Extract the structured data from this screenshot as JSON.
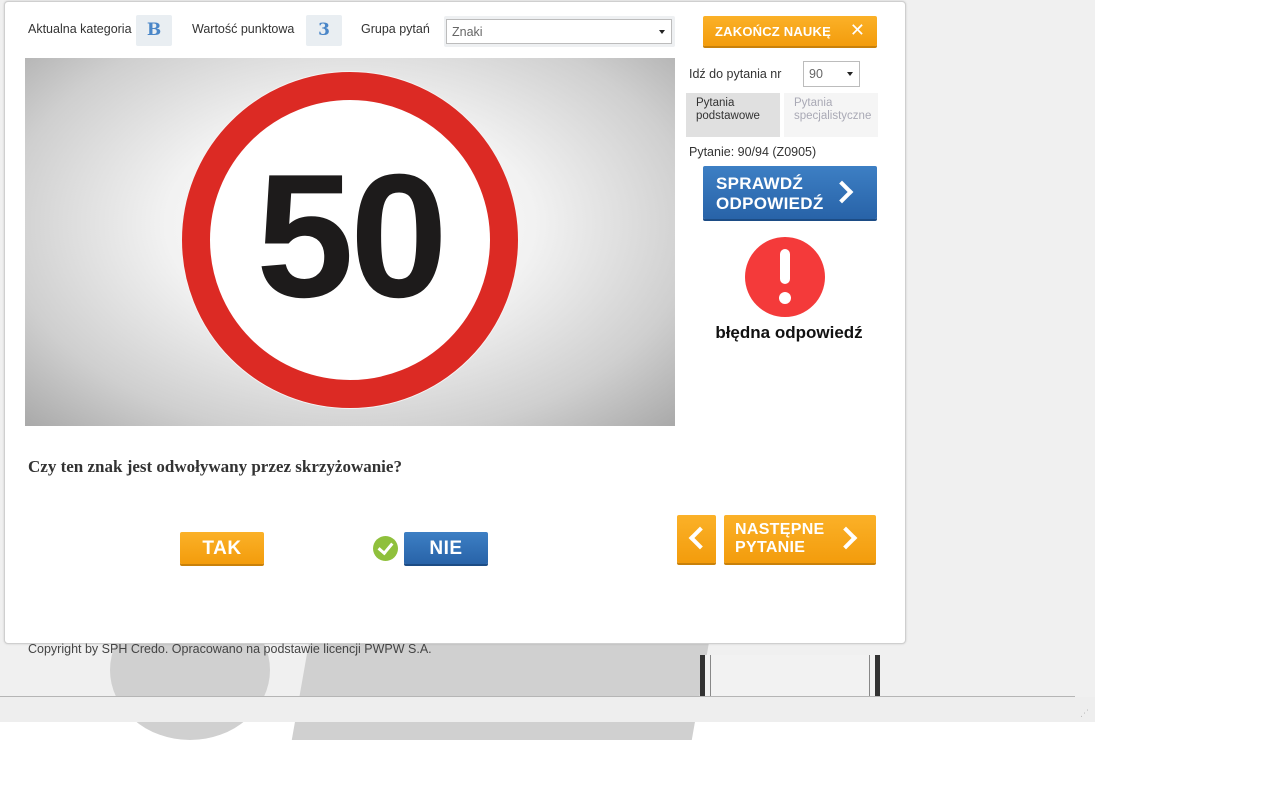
{
  "header": {
    "category_label": "Aktualna kategoria",
    "category_value": "B",
    "points_label": "Wartość punktowa",
    "points_value": "3",
    "group_label": "Grupa pytań",
    "group_selected": "Znaki",
    "end_label": "ZAKOŃCZ NAUKĘ",
    "end_icon": "close-icon"
  },
  "image": {
    "sign_value": "50"
  },
  "sidebar": {
    "goto_label": "Idź do pytania nr",
    "goto_selected": "90",
    "tabs": [
      {
        "line1": "Pytania",
        "line2": "podstawowe",
        "active": true
      },
      {
        "line1": "Pytania",
        "line2": "specjalistyczne",
        "active": false
      }
    ],
    "question_counter": "Pytanie: 90/94 (Z0905)",
    "check_line1": "SPRAWDŹ",
    "check_line2": "ODPOWIEDŹ",
    "result_icon": "exclamation-icon",
    "result_text": "błędna odpowiedź"
  },
  "question": {
    "text": "Czy ten znak jest odwoływany przez skrzyżowanie?",
    "answer_yes": "TAK",
    "answer_no": "NIE",
    "correct_marker": "check-icon"
  },
  "navigation": {
    "next_line1": "NASTĘPNE",
    "next_line2": "PYTANIE"
  },
  "footer": {
    "copyright": "Copyright by SPH Credo. Opracowano na podstawie licencji PWPW S.A."
  },
  "colors": {
    "orange": "#f7a41c",
    "blue": "#2f6fb6",
    "error_red": "#f43a3a",
    "correct_green": "#8fc03c"
  }
}
